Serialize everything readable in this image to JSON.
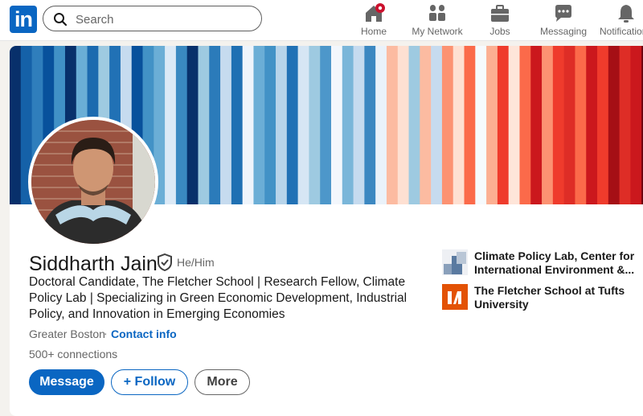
{
  "nav": {
    "search_placeholder": "Search",
    "items": [
      {
        "label": "Home",
        "icon": "home-icon"
      },
      {
        "label": "My Network",
        "icon": "people-icon"
      },
      {
        "label": "Jobs",
        "icon": "briefcase-icon"
      },
      {
        "label": "Messaging",
        "icon": "chat-icon"
      },
      {
        "label": "Notifications",
        "icon": "bell-icon"
      }
    ]
  },
  "profile": {
    "name": "Siddharth Jain",
    "pronouns": "He/Him",
    "headline": "Doctoral Candidate, The Fletcher School | Research Fellow, Climate Policy Lab | Specializing in Green Economic Development, Industrial Policy, and Innovation in Emerging Economies",
    "location": "Greater Boston",
    "separator": "·",
    "contact_label": "Contact info",
    "connections": "500+ connections"
  },
  "actions": {
    "message": "Message",
    "follow": "+ Follow",
    "more": "More"
  },
  "orgs": [
    {
      "name": "Climate Policy Lab, Center for International Environment &...",
      "logo": "climate-policy-lab-logo"
    },
    {
      "name": "The Fletcher School at Tufts University",
      "logo": "fletcher-school-logo"
    }
  ],
  "colors": {
    "brand": "#0a66c2",
    "notification_badge": "#cb112d",
    "fletcher_orange": "#e35205"
  }
}
